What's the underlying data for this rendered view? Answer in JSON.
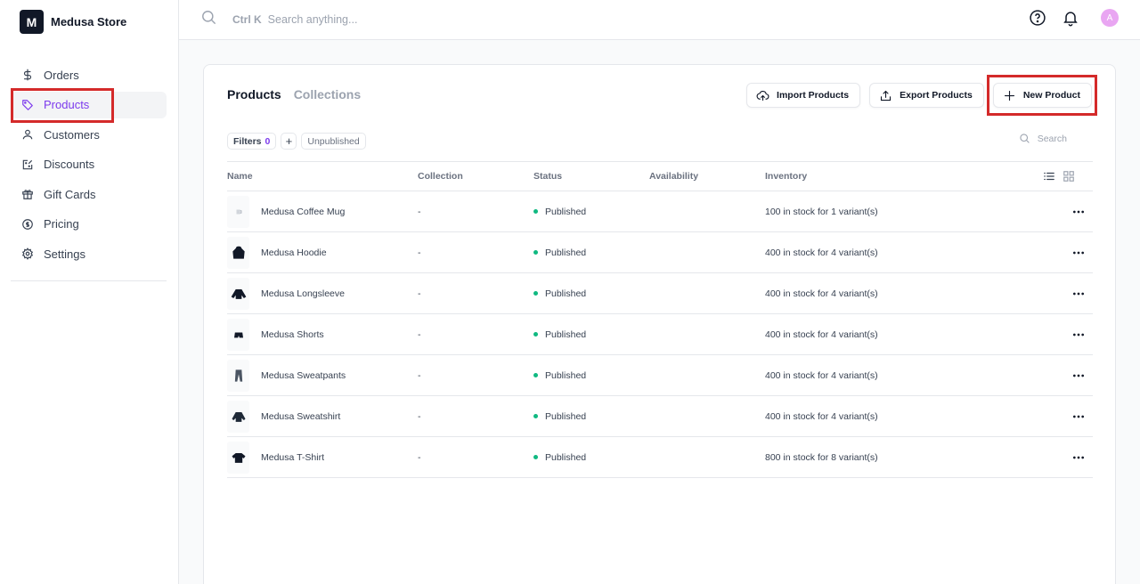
{
  "brand": {
    "logo_letter": "M",
    "name": "Medusa Store"
  },
  "sidebar": {
    "items": [
      {
        "label": "Orders",
        "icon": "dollar-icon"
      },
      {
        "label": "Products",
        "icon": "tag-icon",
        "active": true
      },
      {
        "label": "Customers",
        "icon": "user-icon"
      },
      {
        "label": "Discounts",
        "icon": "discount-icon"
      },
      {
        "label": "Gift Cards",
        "icon": "gift-icon"
      },
      {
        "label": "Pricing",
        "icon": "pricing-icon"
      },
      {
        "label": "Settings",
        "icon": "gear-icon"
      }
    ]
  },
  "topbar": {
    "shortcut": "Ctrl K",
    "search_placeholder": "Search anything...",
    "avatar_letter": "A"
  },
  "tabs": [
    {
      "label": "Products",
      "active": true
    },
    {
      "label": "Collections",
      "active": false
    }
  ],
  "actions": {
    "import_label": "Import Products",
    "export_label": "Export Products",
    "new_label": "New Product"
  },
  "filters": {
    "label": "Filters",
    "count": "0",
    "plus": "+",
    "unpublished": "Unpublished",
    "search_placeholder": "Search"
  },
  "table": {
    "headers": {
      "name": "Name",
      "collection": "Collection",
      "status": "Status",
      "availability": "Availability",
      "inventory": "Inventory"
    },
    "rows": [
      {
        "name": "Medusa Coffee Mug",
        "collection": "-",
        "status": "Published",
        "availability": "",
        "inventory": "100 in stock for 1 variant(s)",
        "thumb": "mug-icon"
      },
      {
        "name": "Medusa Hoodie",
        "collection": "-",
        "status": "Published",
        "availability": "",
        "inventory": "400 in stock for 4 variant(s)",
        "thumb": "hoodie-icon"
      },
      {
        "name": "Medusa Longsleeve",
        "collection": "-",
        "status": "Published",
        "availability": "",
        "inventory": "400 in stock for 4 variant(s)",
        "thumb": "longsleeve-icon"
      },
      {
        "name": "Medusa Shorts",
        "collection": "-",
        "status": "Published",
        "availability": "",
        "inventory": "400 in stock for 4 variant(s)",
        "thumb": "shorts-icon"
      },
      {
        "name": "Medusa Sweatpants",
        "collection": "-",
        "status": "Published",
        "availability": "",
        "inventory": "400 in stock for 4 variant(s)",
        "thumb": "sweatpants-icon"
      },
      {
        "name": "Medusa Sweatshirt",
        "collection": "-",
        "status": "Published",
        "availability": "",
        "inventory": "400 in stock for 4 variant(s)",
        "thumb": "sweatshirt-icon"
      },
      {
        "name": "Medusa T-Shirt",
        "collection": "-",
        "status": "Published",
        "availability": "",
        "inventory": "800 in stock for 8 variant(s)",
        "thumb": "tshirt-icon"
      }
    ]
  },
  "colors": {
    "accent": "#7c3aed",
    "published": "#10b981",
    "highlight": "#d42a2a"
  }
}
